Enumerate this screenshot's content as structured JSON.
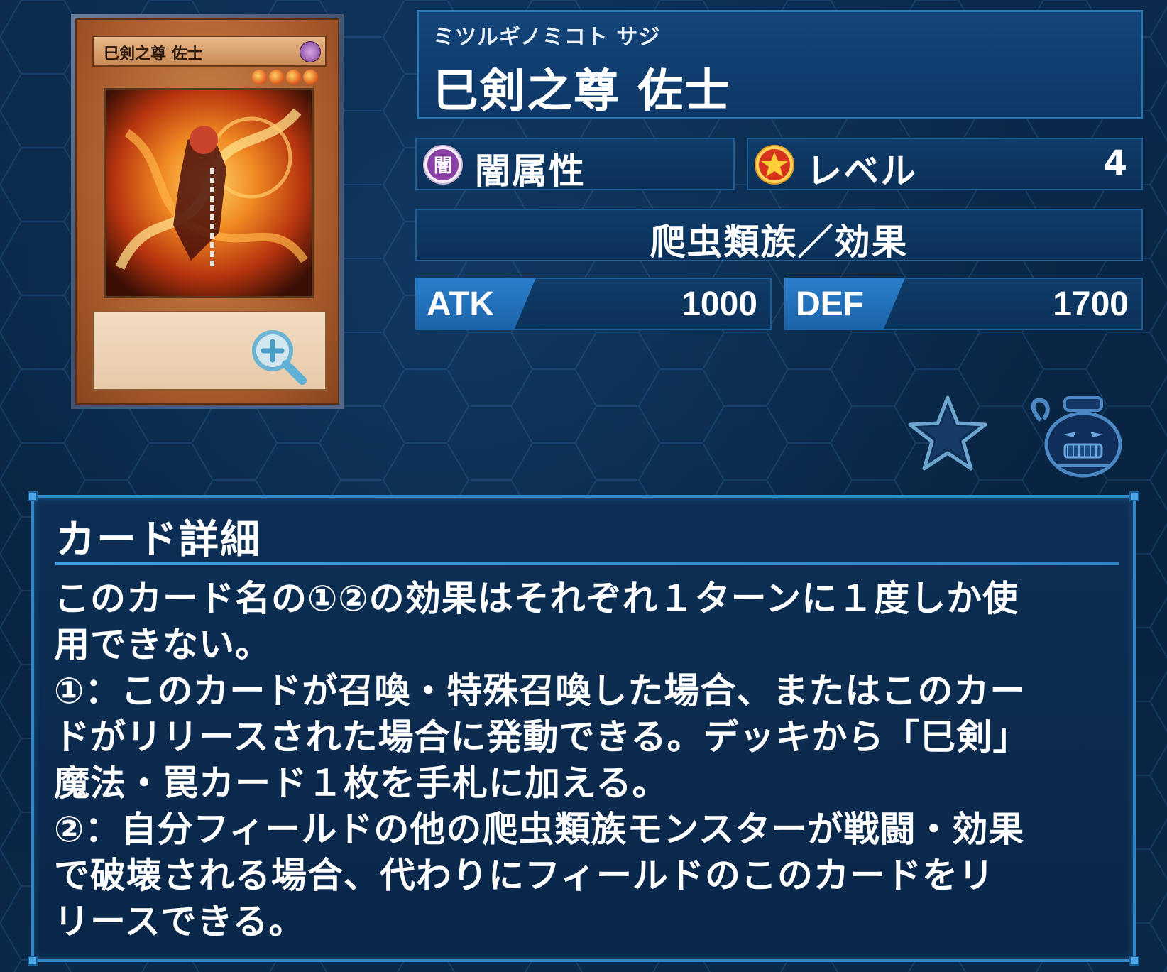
{
  "card": {
    "name_ruby": "ミツルギノミコト サジ",
    "name": "巳剣之尊 佐士",
    "card_image_name": "巳剣之尊 佐士",
    "attribute_icon_glyph": "闇",
    "attribute": "闇属性",
    "level_label": "レベル",
    "level": "4",
    "type": "爬虫類族／効果",
    "atk_label": "ATK",
    "atk": "1000",
    "def_label": "DEF",
    "def": "1700"
  },
  "actions": {
    "zoom_icon": "zoom-in-icon",
    "favorite_icon": "star-icon",
    "pot_icon": "pot-of-greed-icon"
  },
  "detail": {
    "title": "カード詳細",
    "lines": [
      "このカード名の①②の効果はそれぞれ１ターンに１度しか使",
      "用できない。",
      "①：このカードが召喚・特殊召喚した場合、またはこのカー",
      "ドがリリースされた場合に発動できる。デッキから「巳剣」",
      "魔法・罠カード１枚を手札に加える。",
      "②：自分フィールドの他の爬虫類族モンスターが戦闘・効果",
      "で破壊される場合、代わりにフィールドのこのカードをリ",
      "リースできる。"
    ]
  },
  "colors": {
    "background": "#08223f",
    "panel_border": "#2f86c8",
    "tag_blue": "#2b7fcc",
    "text": "#ffffff"
  }
}
